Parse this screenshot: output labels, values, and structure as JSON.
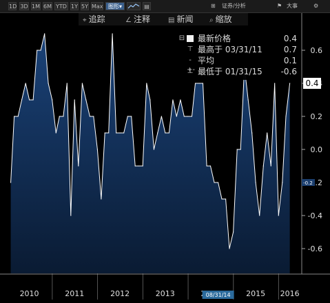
{
  "toolbar": {
    "ranges": [
      "1D",
      "3D",
      "1M",
      "6M",
      "YTD",
      "1Y",
      "5Y",
      "Max"
    ],
    "menu_label": "图形",
    "right_items": [
      "证券/分析",
      "大事"
    ]
  },
  "annotation_bar": {
    "items": [
      {
        "label": "追踪",
        "icon": "crosshair-icon"
      },
      {
        "label": "注释",
        "icon": "pencil-icon"
      },
      {
        "label": "新闻",
        "icon": "news-icon"
      },
      {
        "label": "缩放",
        "icon": "magnifier-icon"
      }
    ]
  },
  "legend": {
    "rows": [
      {
        "label": "最新价格",
        "value": "0.4",
        "icon": "filled-square-icon"
      },
      {
        "label": "最高于 03/31/11",
        "value": "0.7",
        "icon": "high-marker-icon"
      },
      {
        "label": "平均",
        "value": "0.1",
        "icon": "average-marker-icon"
      },
      {
        "label": "最低于 01/31/15",
        "value": "-0.6",
        "icon": "low-marker-icon"
      }
    ]
  },
  "last_value_badge": "0.4",
  "avg_badge": "-0.2",
  "cursor_date": "08/31/14",
  "colors": {
    "background": "#000000",
    "fill_top": "#163a66",
    "fill_bottom": "#0b1f3a",
    "line": "#ffffff",
    "badge": "#ffffff"
  },
  "chart_data": {
    "type": "area",
    "title": "",
    "xlabel": "",
    "ylabel": "",
    "x_range": [
      "2009-12-31",
      "2016-06-30"
    ],
    "ylim": [
      -0.75,
      0.75
    ],
    "y_ticks": [
      0.6,
      0.4,
      0.2,
      0.0,
      -0.2,
      -0.4,
      -0.6
    ],
    "y_tick_labels": [
      "0.6",
      "0.4",
      "0.2",
      "0.0",
      "-0.2",
      "-0.4",
      "-0.6"
    ],
    "x_tick_labels": [
      "2010",
      "2011",
      "2012",
      "2013",
      "2014",
      "2015",
      "2016"
    ],
    "x_tick_dates": [
      "2010-06-30",
      "2011-06-30",
      "2012-06-30",
      "2013-06-30",
      "2014-06-30",
      "2015-06-30",
      "2016-03-31"
    ],
    "series": [
      {
        "points": [
          [
            "2010-01-31",
            -0.2
          ],
          [
            "2010-02-28",
            0.2
          ],
          [
            "2010-03-31",
            0.2
          ],
          [
            "2010-04-30",
            0.3
          ],
          [
            "2010-05-31",
            0.4
          ],
          [
            "2010-06-30",
            0.3
          ],
          [
            "2010-07-31",
            0.3
          ],
          [
            "2010-08-31",
            0.6
          ],
          [
            "2010-09-30",
            0.6
          ],
          [
            "2010-10-31",
            0.7
          ],
          [
            "2010-11-30",
            0.4
          ],
          [
            "2010-12-31",
            0.3
          ],
          [
            "2011-01-31",
            0.1
          ],
          [
            "2011-02-28",
            0.2
          ],
          [
            "2011-03-31",
            0.2
          ],
          [
            "2011-04-30",
            0.4
          ],
          [
            "2011-05-31",
            -0.4
          ],
          [
            "2011-06-30",
            0.3
          ],
          [
            "2011-07-31",
            -0.1
          ],
          [
            "2011-08-31",
            0.4
          ],
          [
            "2011-09-30",
            0.3
          ],
          [
            "2011-10-31",
            0.2
          ],
          [
            "2011-11-30",
            0.2
          ],
          [
            "2011-12-31",
            0.0
          ],
          [
            "2012-01-31",
            -0.3
          ],
          [
            "2012-02-29",
            0.1
          ],
          [
            "2012-03-31",
            0.1
          ],
          [
            "2012-04-30",
            0.7
          ],
          [
            "2012-05-31",
            0.1
          ],
          [
            "2012-06-30",
            0.1
          ],
          [
            "2012-07-31",
            0.1
          ],
          [
            "2012-08-31",
            0.2
          ],
          [
            "2012-09-30",
            0.2
          ],
          [
            "2012-10-31",
            -0.1
          ],
          [
            "2012-11-30",
            -0.1
          ],
          [
            "2012-12-31",
            -0.1
          ],
          [
            "2013-01-31",
            0.4
          ],
          [
            "2013-02-28",
            0.3
          ],
          [
            "2013-03-31",
            0.0
          ],
          [
            "2013-04-30",
            0.1
          ],
          [
            "2013-05-31",
            0.2
          ],
          [
            "2013-06-30",
            0.1
          ],
          [
            "2013-07-31",
            0.1
          ],
          [
            "2013-08-31",
            0.3
          ],
          [
            "2013-09-30",
            0.2
          ],
          [
            "2013-10-31",
            0.3
          ],
          [
            "2013-11-30",
            0.2
          ],
          [
            "2013-12-31",
            0.2
          ],
          [
            "2014-01-31",
            0.2
          ],
          [
            "2014-02-28",
            0.4
          ],
          [
            "2014-03-31",
            0.4
          ],
          [
            "2014-04-30",
            0.4
          ],
          [
            "2014-05-31",
            -0.1
          ],
          [
            "2014-06-30",
            -0.1
          ],
          [
            "2014-07-31",
            -0.2
          ],
          [
            "2014-08-31",
            -0.2
          ],
          [
            "2014-09-30",
            -0.3
          ],
          [
            "2014-10-31",
            -0.3
          ],
          [
            "2014-11-30",
            -0.6
          ],
          [
            "2014-12-31",
            -0.5
          ],
          [
            "2015-01-31",
            0.0
          ],
          [
            "2015-02-28",
            0.0
          ],
          [
            "2015-03-31",
            0.5
          ],
          [
            "2015-04-30",
            0.3
          ],
          [
            "2015-05-31",
            0.1
          ],
          [
            "2015-06-30",
            -0.2
          ],
          [
            "2015-07-31",
            -0.4
          ],
          [
            "2015-08-31",
            -0.1
          ],
          [
            "2015-09-30",
            0.1
          ],
          [
            "2015-10-31",
            -0.1
          ],
          [
            "2015-11-30",
            0.4
          ],
          [
            "2015-12-31",
            -0.4
          ],
          [
            "2016-01-31",
            -0.2
          ],
          [
            "2016-02-29",
            0.2
          ],
          [
            "2016-03-31",
            0.4
          ]
        ]
      }
    ],
    "grid": false,
    "legend_position": "top-right"
  }
}
